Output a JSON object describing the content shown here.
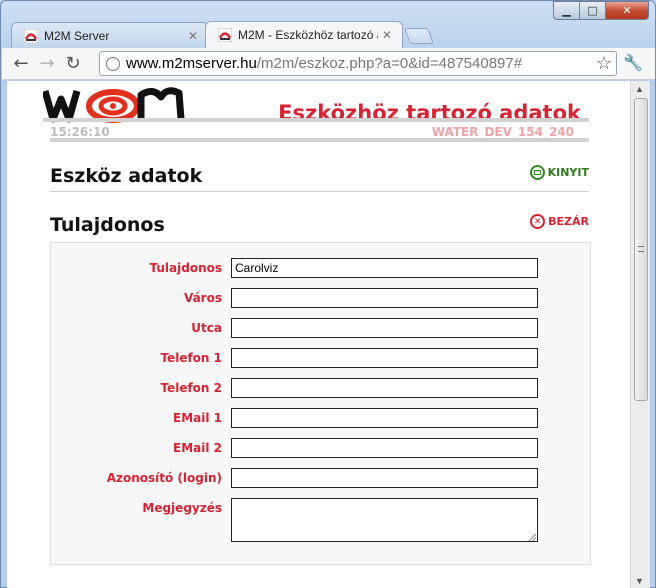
{
  "browser": {
    "tabs": [
      {
        "title": "M2M Server",
        "active": false
      },
      {
        "title": "M2M - Eszközhöz tartozó adatok",
        "active": true
      }
    ],
    "url_host": "www.m2mserver.hu",
    "url_path": "/m2m/eszkoz.php?a=0&id=487540897#"
  },
  "page": {
    "logo_text": "W2M",
    "heading": "Eszközhöz tartozó adatok",
    "clock": "15:26:10",
    "device_id": "WATER_DEV_154_240"
  },
  "sections": {
    "device_data": {
      "title": "Eszköz adatok",
      "action": "KINYIT"
    },
    "owner": {
      "title": "Tulajdonos",
      "action": "BEZÁR"
    }
  },
  "form": {
    "fields": [
      {
        "label": "Tulajdonos",
        "value": "Carolviz"
      },
      {
        "label": "Város",
        "value": ""
      },
      {
        "label": "Utca",
        "value": ""
      },
      {
        "label": "Telefon 1",
        "value": ""
      },
      {
        "label": "Telefon 2",
        "value": ""
      },
      {
        "label": "EMail 1",
        "value": ""
      },
      {
        "label": "EMail 2",
        "value": ""
      },
      {
        "label": "Azonosító (login)",
        "value": ""
      },
      {
        "label": "Megjegyzés",
        "value": ""
      }
    ]
  },
  "colors": {
    "accent_red": "#d72331",
    "open_green": "#2f8a22"
  }
}
